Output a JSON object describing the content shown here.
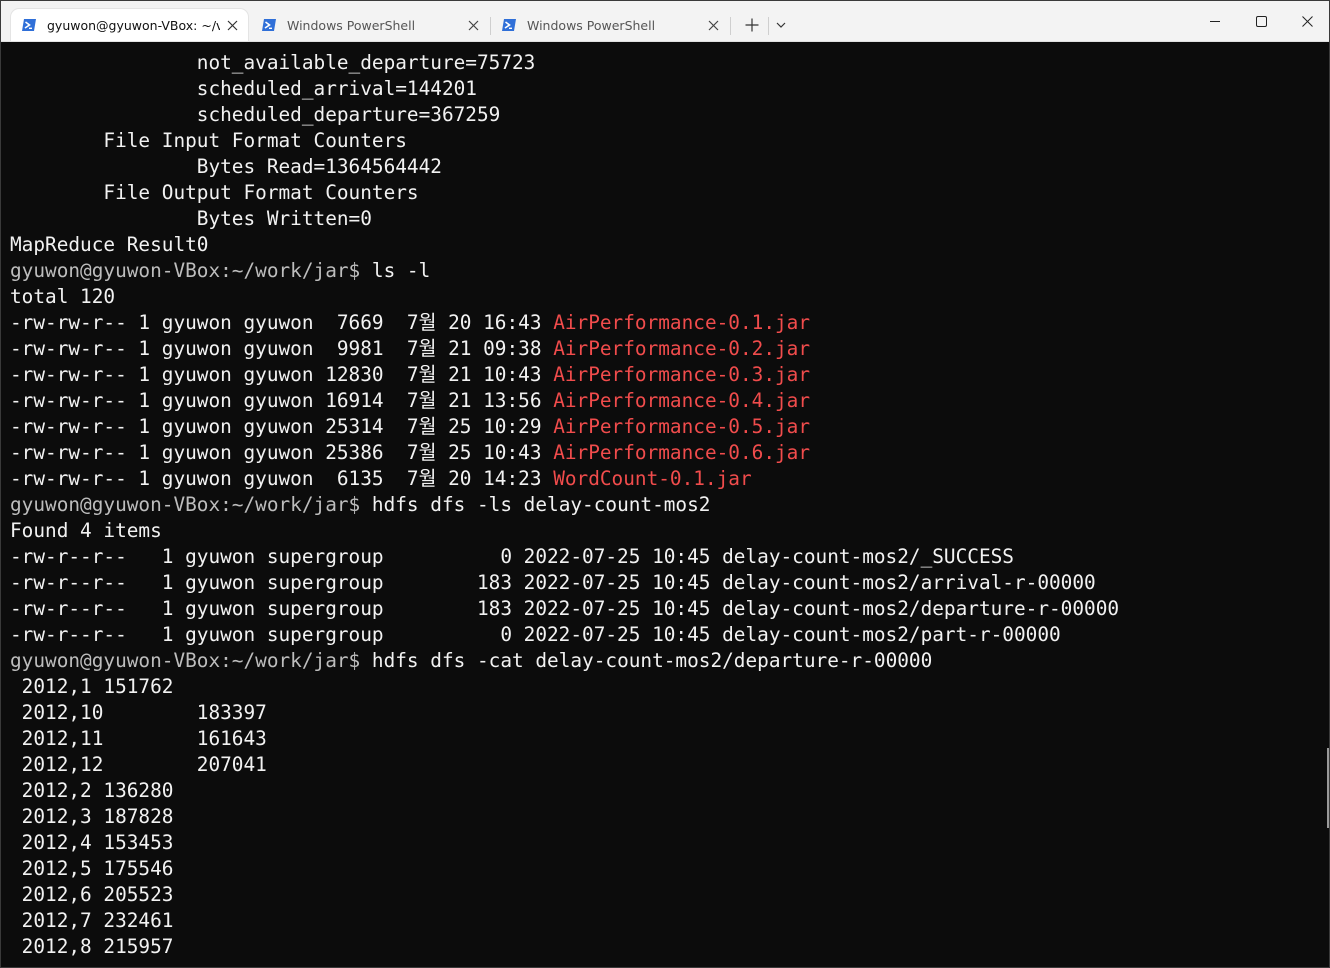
{
  "tabs": [
    {
      "title": "gyuwon@gyuwon-VBox: ~/v",
      "active": true
    },
    {
      "title": "Windows PowerShell",
      "active": false
    },
    {
      "title": "Windows PowerShell",
      "active": false
    }
  ],
  "toolbar": {
    "new_tab_icon": "plus-icon",
    "dropdown_icon": "chevron-down-icon"
  },
  "window_controls": {
    "minimize_icon": "minimize-icon",
    "maximize_icon": "maximize-icon",
    "close_icon": "close-icon"
  },
  "colors": {
    "terminal_bg": "#0c0c0c",
    "text": "#f2f2f2",
    "prompt": "#bdbdbd",
    "jar_file": "#f14c4c",
    "powershell_icon": "#2f6fd8"
  },
  "terminal": {
    "lines": [
      [
        {
          "t": "                not_available_departure=75723",
          "c": "fg"
        }
      ],
      [
        {
          "t": "                scheduled_arrival=144201",
          "c": "fg"
        }
      ],
      [
        {
          "t": "                scheduled_departure=367259",
          "c": "fg"
        }
      ],
      [
        {
          "t": "        File Input Format Counters",
          "c": "fg"
        }
      ],
      [
        {
          "t": "                Bytes Read=1364564442",
          "c": "fg"
        }
      ],
      [
        {
          "t": "        File Output Format Counters",
          "c": "fg"
        }
      ],
      [
        {
          "t": "                Bytes Written=0",
          "c": "fg"
        }
      ],
      [
        {
          "t": "MapReduce Result0",
          "c": "fg"
        }
      ],
      [
        {
          "t": "gyuwon@gyuwon-VBox:~/work/jar$",
          "c": "prompt"
        },
        {
          "t": " ls -l",
          "c": "fg"
        }
      ],
      [
        {
          "t": "total 120",
          "c": "fg"
        }
      ],
      [
        {
          "t": "-rw-rw-r-- 1 gyuwon gyuwon  7669  7월 20 16:43 ",
          "c": "fg"
        },
        {
          "t": "AirPerformance-0.1.jar",
          "c": "red"
        }
      ],
      [
        {
          "t": "-rw-rw-r-- 1 gyuwon gyuwon  9981  7월 21 09:38 ",
          "c": "fg"
        },
        {
          "t": "AirPerformance-0.2.jar",
          "c": "red"
        }
      ],
      [
        {
          "t": "-rw-rw-r-- 1 gyuwon gyuwon 12830  7월 21 10:43 ",
          "c": "fg"
        },
        {
          "t": "AirPerformance-0.3.jar",
          "c": "red"
        }
      ],
      [
        {
          "t": "-rw-rw-r-- 1 gyuwon gyuwon 16914  7월 21 13:56 ",
          "c": "fg"
        },
        {
          "t": "AirPerformance-0.4.jar",
          "c": "red"
        }
      ],
      [
        {
          "t": "-rw-rw-r-- 1 gyuwon gyuwon 25314  7월 25 10:29 ",
          "c": "fg"
        },
        {
          "t": "AirPerformance-0.5.jar",
          "c": "red"
        }
      ],
      [
        {
          "t": "-rw-rw-r-- 1 gyuwon gyuwon 25386  7월 25 10:43 ",
          "c": "fg"
        },
        {
          "t": "AirPerformance-0.6.jar",
          "c": "red"
        }
      ],
      [
        {
          "t": "-rw-rw-r-- 1 gyuwon gyuwon  6135  7월 20 14:23 ",
          "c": "fg"
        },
        {
          "t": "WordCount-0.1.jar",
          "c": "red"
        }
      ],
      [
        {
          "t": "gyuwon@gyuwon-VBox:~/work/jar$",
          "c": "prompt"
        },
        {
          "t": " hdfs dfs -ls delay-count-mos2",
          "c": "fg"
        }
      ],
      [
        {
          "t": "Found 4 items",
          "c": "fg"
        }
      ],
      [
        {
          "t": "-rw-r--r--   1 gyuwon supergroup          0 2022-07-25 10:45 delay-count-mos2/_SUCCESS",
          "c": "fg"
        }
      ],
      [
        {
          "t": "-rw-r--r--   1 gyuwon supergroup        183 2022-07-25 10:45 delay-count-mos2/arrival-r-00000",
          "c": "fg"
        }
      ],
      [
        {
          "t": "-rw-r--r--   1 gyuwon supergroup        183 2022-07-25 10:45 delay-count-mos2/departure-r-00000",
          "c": "fg"
        }
      ],
      [
        {
          "t": "-rw-r--r--   1 gyuwon supergroup          0 2022-07-25 10:45 delay-count-mos2/part-r-00000",
          "c": "fg"
        }
      ],
      [
        {
          "t": "gyuwon@gyuwon-VBox:~/work/jar$",
          "c": "prompt"
        },
        {
          "t": " hdfs dfs -cat delay-count-mos2/departure-r-00000",
          "c": "fg"
        }
      ],
      [
        {
          "t": " 2012,1 151762",
          "c": "fg"
        }
      ],
      [
        {
          "t": " 2012,10        183397",
          "c": "fg"
        }
      ],
      [
        {
          "t": " 2012,11        161643",
          "c": "fg"
        }
      ],
      [
        {
          "t": " 2012,12        207041",
          "c": "fg"
        }
      ],
      [
        {
          "t": " 2012,2 136280",
          "c": "fg"
        }
      ],
      [
        {
          "t": " 2012,3 187828",
          "c": "fg"
        }
      ],
      [
        {
          "t": " 2012,4 153453",
          "c": "fg"
        }
      ],
      [
        {
          "t": " 2012,5 175546",
          "c": "fg"
        }
      ],
      [
        {
          "t": " 2012,6 205523",
          "c": "fg"
        }
      ],
      [
        {
          "t": " 2012,7 232461",
          "c": "fg"
        }
      ],
      [
        {
          "t": " 2012,8 215957",
          "c": "fg"
        }
      ]
    ]
  }
}
